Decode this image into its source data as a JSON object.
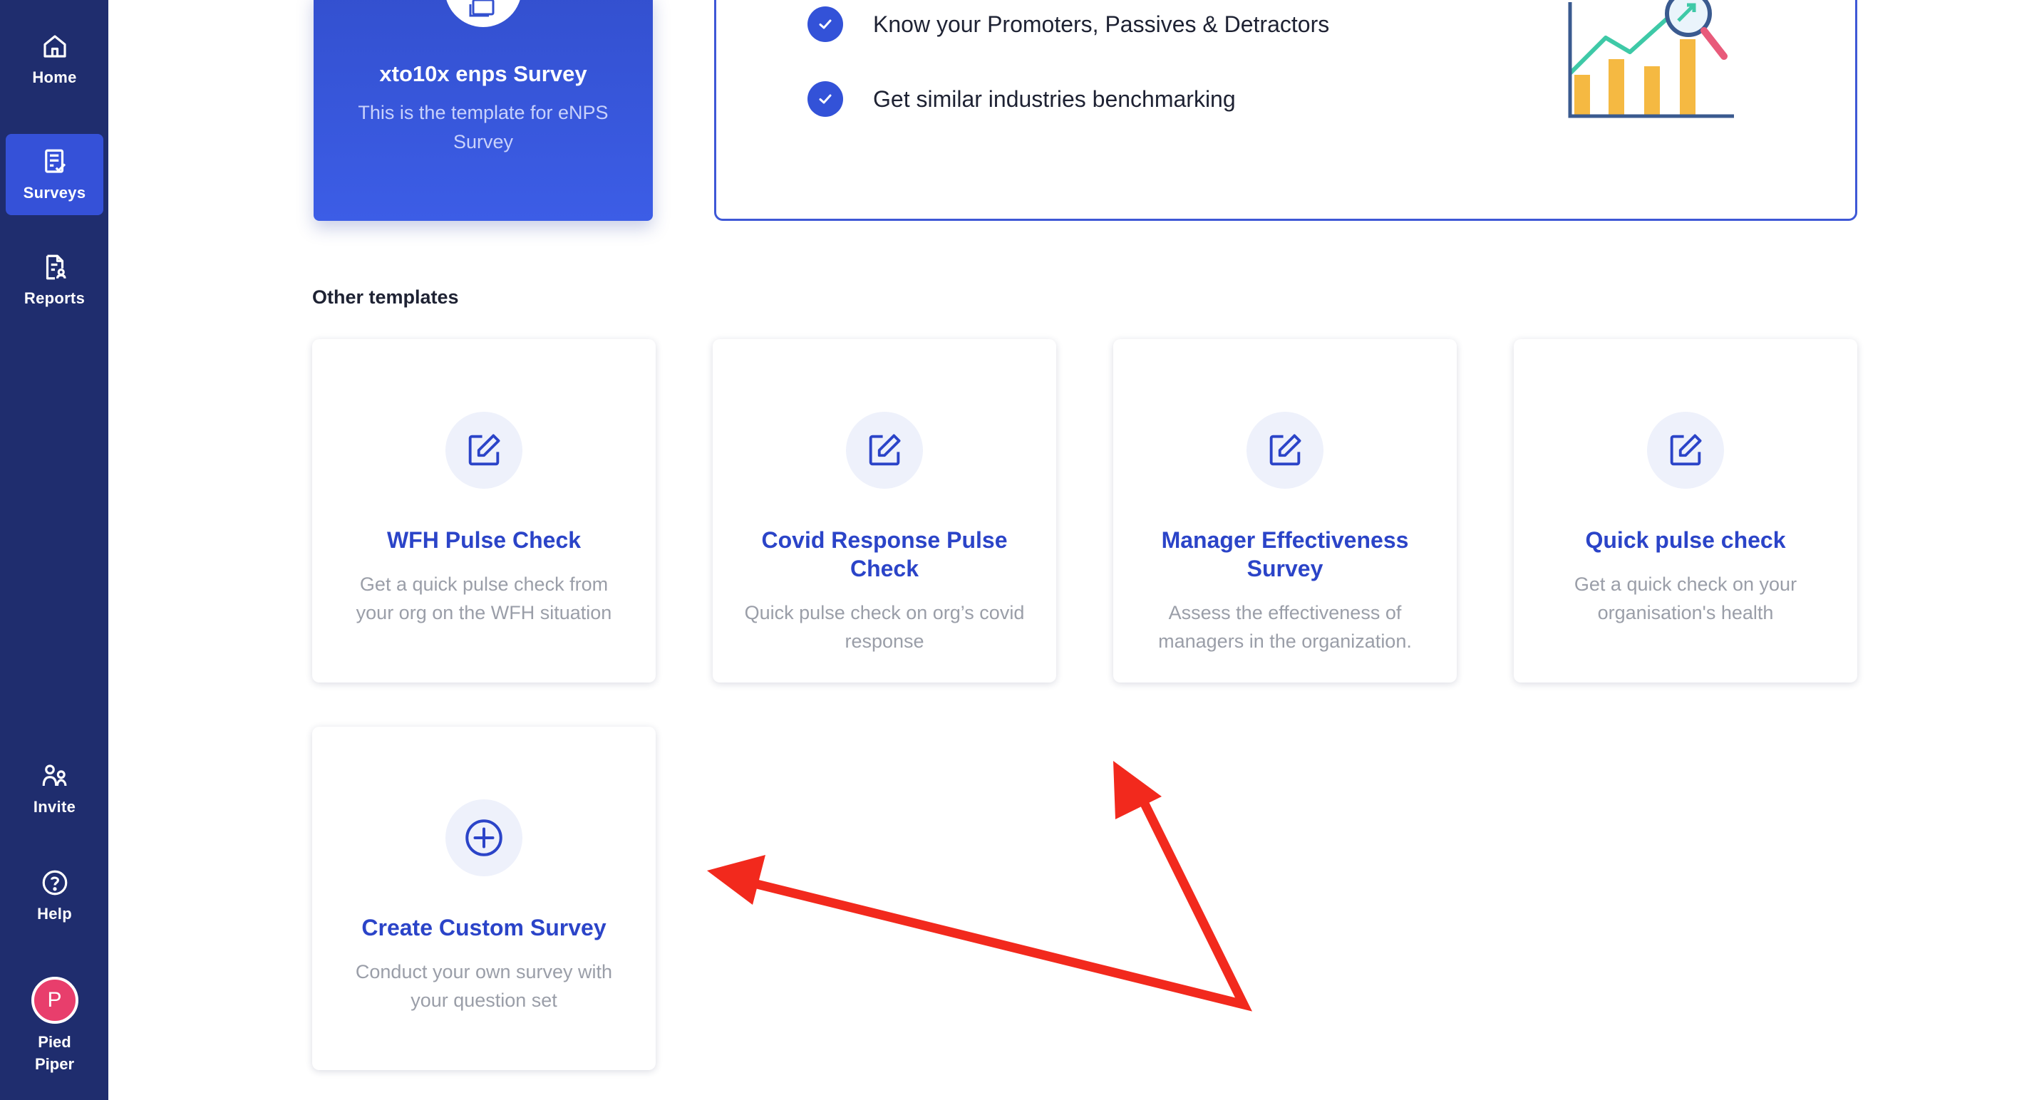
{
  "sidebar": {
    "items": [
      {
        "label": "Home",
        "icon": "home-icon"
      },
      {
        "label": "Surveys",
        "icon": "surveys-icon",
        "active": true
      },
      {
        "label": "Reports",
        "icon": "reports-icon"
      },
      {
        "label": "Invite",
        "icon": "invite-icon"
      },
      {
        "label": "Help",
        "icon": "help-icon"
      }
    ],
    "org": {
      "initial": "P",
      "name_line1": "Pied",
      "name_line2": "Piper"
    }
  },
  "featured": {
    "title": "xto10x enps Survey",
    "description": "This is the template for eNPS Survey"
  },
  "benefits": [
    "Know your Promoters, Passives & Detractors",
    "Get similar industries benchmarking"
  ],
  "section_title": "Other templates",
  "templates": [
    {
      "title": "WFH Pulse Check",
      "description": "Get a quick pulse check from your org on the WFH situation"
    },
    {
      "title": "Covid Response Pulse Check",
      "description": "Quick pulse check on org’s covid response"
    },
    {
      "title": "Manager Effectiveness Survey",
      "description": "Assess the effectiveness of managers in the organization."
    },
    {
      "title": "Quick pulse check",
      "description": "Get a quick check on your organisation's health"
    }
  ],
  "custom": {
    "title": "Create Custom Survey",
    "description": "Conduct your own survey with your question set"
  },
  "colors": {
    "sidebar_bg": "#1f2d6e",
    "accent": "#3551d8",
    "card_title": "#2b44c8",
    "annotation": "#f2291d"
  }
}
